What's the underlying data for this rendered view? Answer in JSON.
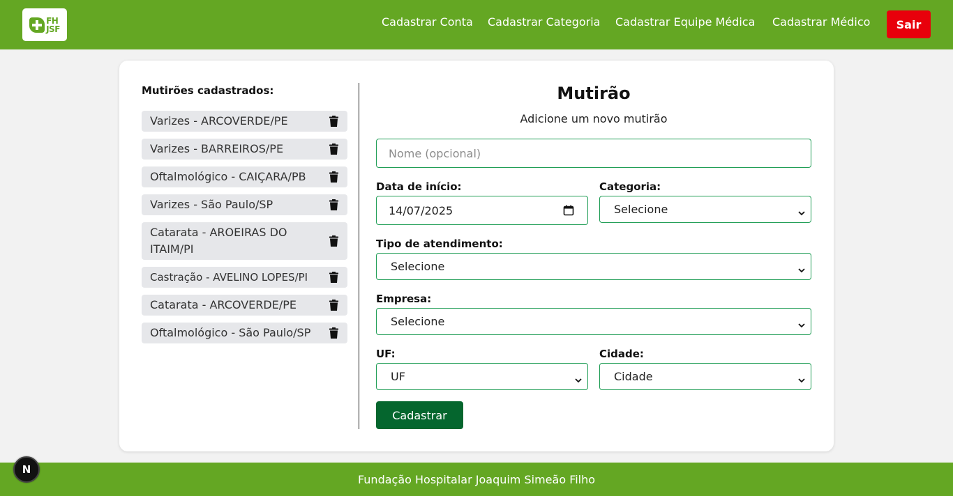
{
  "header": {
    "logo_text": "FH JSF",
    "nav": [
      {
        "label": "Cadastrar Conta"
      },
      {
        "label": "Cadastrar Categoria"
      },
      {
        "label": "Cadastrar Equipe Médica"
      },
      {
        "label": "Cadastrar Médico"
      }
    ],
    "logout_label": "Sair"
  },
  "list": {
    "title": "Mutirões cadastrados:",
    "items": [
      {
        "label": "Varizes - ARCOVERDE/PE"
      },
      {
        "label": "Varizes - BARREIROS/PE"
      },
      {
        "label": "Oftalmológico - CAIÇARA/PB"
      },
      {
        "label": "Varizes - São Paulo/SP"
      },
      {
        "label": "Catarata - AROEIRAS DO ITAIM/PI"
      },
      {
        "label": "Castração - AVELINO LOPES/PI"
      },
      {
        "label": "Catarata - ARCOVERDE/PE"
      },
      {
        "label": "Oftalmológico - São Paulo/SP"
      }
    ]
  },
  "form": {
    "title": "Mutirão",
    "subtitle": "Adicione um novo mutirão",
    "name_placeholder": "Nome (opcional)",
    "start_date_label": "Data de início:",
    "start_date_value": "14/07/2025",
    "category_label": "Categoria:",
    "category_value": "Selecione",
    "service_type_label": "Tipo de atendimento:",
    "service_type_value": "Selecione",
    "company_label": "Empresa:",
    "company_value": "Selecione",
    "uf_label": "UF:",
    "uf_value": "UF",
    "city_label": "Cidade:",
    "city_value": "Cidade",
    "submit_label": "Cadastrar"
  },
  "footer": {
    "text": "Fundação Hospitalar Joaquim Simeão Filho"
  },
  "dev_badge": {
    "letter": "N"
  },
  "colors": {
    "header_green": "#64a723",
    "field_border": "#1f9d55",
    "submit_button": "#05662e",
    "logout_button": "#e8000b"
  }
}
